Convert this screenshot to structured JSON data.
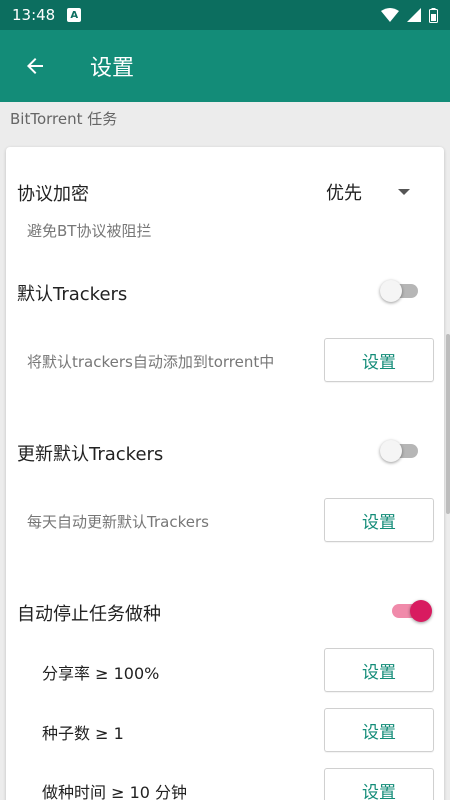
{
  "status_bar": {
    "time": "13:48",
    "notification_letter": "A"
  },
  "app_bar": {
    "title": "设置"
  },
  "section": {
    "header": "BitTorrent 任务"
  },
  "settings": {
    "encryption": {
      "label": "协议加密",
      "value": "优先",
      "description": "避免BT协议被阻拦"
    },
    "default_trackers": {
      "label": "默认Trackers",
      "enabled": false,
      "description": "将默认trackers自动添加到torrent中",
      "button": "设置"
    },
    "update_trackers": {
      "label": "更新默认Trackers",
      "enabled": false,
      "description": "每天自动更新默认Trackers",
      "button": "设置"
    },
    "auto_stop_seeding": {
      "label": "自动停止任务做种",
      "enabled": true,
      "conditions": [
        {
          "label": "分享率 ≥ 100%",
          "button": "设置"
        },
        {
          "label": "种子数 ≥ 1",
          "button": "设置"
        },
        {
          "label": "做种时间 ≥ 10 分钟",
          "button": "设置"
        }
      ]
    }
  },
  "colors": {
    "status_bar": "#0c6e5f",
    "app_bar": "#138c78",
    "accent": "#138c78",
    "switch_on": "#d81b60"
  },
  "icons": {
    "back": "arrow-left-icon",
    "wifi": "wifi-icon",
    "signal": "cellular-signal-icon",
    "battery": "battery-icon"
  }
}
